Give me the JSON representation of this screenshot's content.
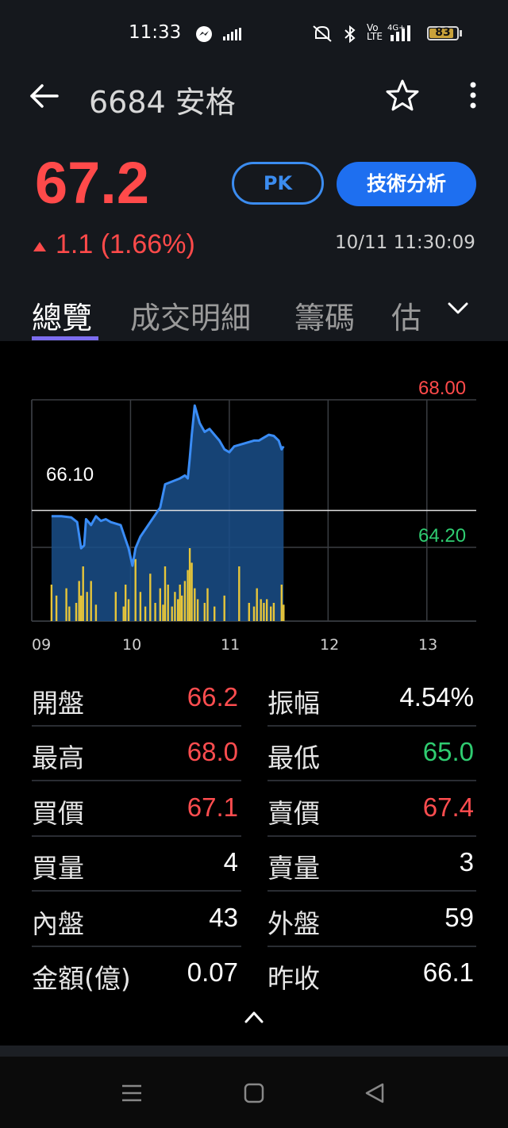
{
  "status_bar": {
    "time": "11:33",
    "battery": "83"
  },
  "header": {
    "title": "6684 安格"
  },
  "quote": {
    "price": "67.2",
    "change": "1.1 (1.66%)",
    "timestamp": "10/11 11:30:09"
  },
  "buttons": {
    "pk": "PK",
    "tech_analysis": "技術分析"
  },
  "tabs": [
    {
      "label": "總覽",
      "active": true
    },
    {
      "label": "成交明細",
      "active": false
    },
    {
      "label": "籌碼",
      "active": false
    },
    {
      "label": "估",
      "active": false
    }
  ],
  "chart_data": {
    "type": "area",
    "x_ticks": [
      "09",
      "10",
      "11",
      "12",
      "13"
    ],
    "y_labels": {
      "high": "68.00",
      "ref": "66.10",
      "low": "64.20"
    },
    "ylim": [
      64.2,
      68.0
    ],
    "reference_price": 66.1,
    "x_unit_hours": [
      9,
      13.5
    ],
    "price_series": [
      [
        9.2,
        66.0
      ],
      [
        9.3,
        66.0
      ],
      [
        9.4,
        65.98
      ],
      [
        9.46,
        65.9
      ],
      [
        9.5,
        65.45
      ],
      [
        9.53,
        65.5
      ],
      [
        9.55,
        65.95
      ],
      [
        9.6,
        65.85
      ],
      [
        9.65,
        66.0
      ],
      [
        9.7,
        65.92
      ],
      [
        9.75,
        65.95
      ],
      [
        9.8,
        65.9
      ],
      [
        9.9,
        65.85
      ],
      [
        9.95,
        65.6
      ],
      [
        9.98,
        65.45
      ],
      [
        10.02,
        65.15
      ],
      [
        10.05,
        65.45
      ],
      [
        10.1,
        65.65
      ],
      [
        10.2,
        65.9
      ],
      [
        10.3,
        66.15
      ],
      [
        10.35,
        66.55
      ],
      [
        10.5,
        66.65
      ],
      [
        10.55,
        66.7
      ],
      [
        10.58,
        66.65
      ],
      [
        10.6,
        67.0
      ],
      [
        10.62,
        67.4
      ],
      [
        10.65,
        67.9
      ],
      [
        10.7,
        67.6
      ],
      [
        10.75,
        67.45
      ],
      [
        10.8,
        67.5
      ],
      [
        10.85,
        67.4
      ],
      [
        10.9,
        67.3
      ],
      [
        10.95,
        67.15
      ],
      [
        11.0,
        67.1
      ],
      [
        11.05,
        67.2
      ],
      [
        11.15,
        67.25
      ],
      [
        11.25,
        67.3
      ],
      [
        11.3,
        67.3
      ],
      [
        11.35,
        67.35
      ],
      [
        11.4,
        67.4
      ],
      [
        11.45,
        67.38
      ],
      [
        11.5,
        67.3
      ],
      [
        11.53,
        67.15
      ],
      [
        11.55,
        67.2
      ]
    ],
    "volume_series": [
      [
        9.2,
        20
      ],
      [
        9.25,
        14
      ],
      [
        9.35,
        18
      ],
      [
        9.38,
        8
      ],
      [
        9.45,
        10
      ],
      [
        9.48,
        22
      ],
      [
        9.5,
        14
      ],
      [
        9.52,
        30
      ],
      [
        9.56,
        16
      ],
      [
        9.6,
        22
      ],
      [
        9.65,
        9
      ],
      [
        9.85,
        16
      ],
      [
        9.93,
        8
      ],
      [
        9.95,
        20
      ],
      [
        9.98,
        12
      ],
      [
        10.05,
        34
      ],
      [
        10.1,
        16
      ],
      [
        10.15,
        8
      ],
      [
        10.2,
        26
      ],
      [
        10.25,
        10
      ],
      [
        10.3,
        18
      ],
      [
        10.33,
        9
      ],
      [
        10.35,
        30
      ],
      [
        10.38,
        20
      ],
      [
        10.42,
        8
      ],
      [
        10.45,
        16
      ],
      [
        10.48,
        12
      ],
      [
        10.5,
        20
      ],
      [
        10.52,
        14
      ],
      [
        10.55,
        22
      ],
      [
        10.58,
        28
      ],
      [
        10.6,
        40
      ],
      [
        10.62,
        32
      ],
      [
        10.65,
        18
      ],
      [
        10.68,
        12
      ],
      [
        10.75,
        10
      ],
      [
        10.78,
        18
      ],
      [
        10.85,
        8
      ],
      [
        10.95,
        14
      ],
      [
        11.1,
        30
      ],
      [
        11.2,
        10
      ],
      [
        11.25,
        8
      ],
      [
        11.28,
        18
      ],
      [
        11.32,
        12
      ],
      [
        11.35,
        10
      ],
      [
        11.38,
        12
      ],
      [
        11.42,
        8
      ],
      [
        11.45,
        10
      ],
      [
        11.53,
        20
      ],
      [
        11.55,
        9
      ]
    ]
  },
  "stats": {
    "left": [
      {
        "label": "開盤",
        "value": "66.2",
        "color": "red"
      },
      {
        "label": "最高",
        "value": "68.0",
        "color": "red"
      },
      {
        "label": "買價",
        "value": "67.1",
        "color": "red"
      },
      {
        "label": "買量",
        "value": "4",
        "color": "white"
      },
      {
        "label": "內盤",
        "value": "43",
        "color": "white"
      },
      {
        "label": "金額(億)",
        "value": "0.07",
        "color": "white"
      }
    ],
    "right": [
      {
        "label": "振幅",
        "value": "4.54%",
        "color": "white"
      },
      {
        "label": "最低",
        "value": "65.0",
        "color": "green"
      },
      {
        "label": "賣價",
        "value": "67.4",
        "color": "red"
      },
      {
        "label": "賣量",
        "value": "3",
        "color": "white"
      },
      {
        "label": "外盤",
        "value": "59",
        "color": "white"
      },
      {
        "label": "昨收",
        "value": "66.1",
        "color": "white"
      }
    ]
  },
  "colors": {
    "up": "#ff4a4a",
    "down": "#2fcc71",
    "accent": "#1e6ff0",
    "chart_line": "#3a8cf5",
    "volume": "#e6c53a"
  },
  "icons": [
    "back-arrow-icon",
    "star-icon",
    "more-vertical-icon",
    "chevron-down-icon",
    "chevron-up-icon"
  ]
}
